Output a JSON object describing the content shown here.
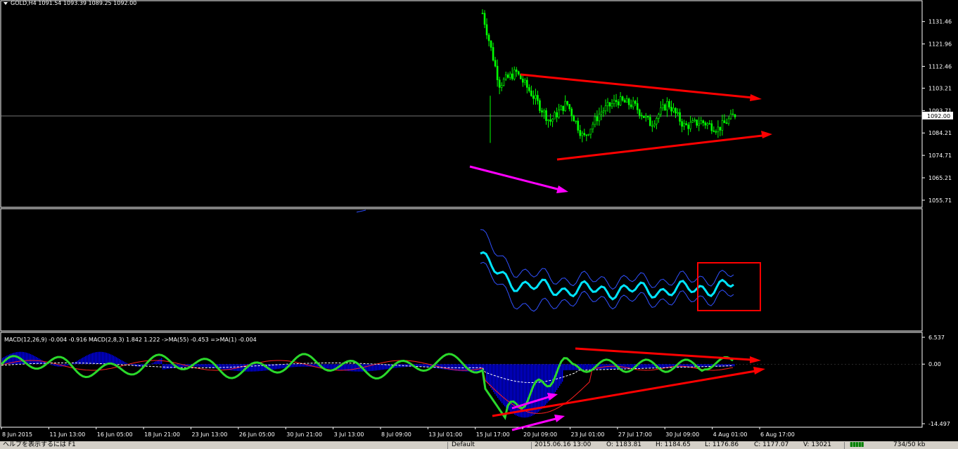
{
  "chart_title": "GOLD,H4  1091.54 1093.39 1089.25 1092.00",
  "current_price_label": "1092.00",
  "price_axis_labels": [
    "1131.46",
    "1121.96",
    "1112.46",
    "1103.21",
    "1093.71",
    "1084.21",
    "1074.71",
    "1065.21",
    "1055.71"
  ],
  "price_axis_values": [
    1131.46,
    1121.96,
    1112.46,
    1103.21,
    1093.71,
    1084.21,
    1074.71,
    1065.21,
    1055.71
  ],
  "macd_header": "MACD(12,26,9) -0.004 -0.916  MACD(2,8,3) 1.842 1.222  ->MA(55) -0.453  =>MA(1) -0.004",
  "macd_axis_labels": [
    "6.537",
    "0.00",
    "-14.497"
  ],
  "macd_axis_values": [
    6.537,
    0.0,
    -14.497
  ],
  "time_labels": [
    "8 Jun 2015",
    "11 Jun 13:00",
    "16 Jun 05:00",
    "18 Jun 21:00",
    "23 Jun 13:00",
    "26 Jun 05:00",
    "30 Jun 21:00",
    "3 Jul 13:00",
    "8 Jul 09:00",
    "13 Jul 01:00",
    "15 Jul 17:00",
    "20 Jul 09:00",
    "23 Jul 01:00",
    "27 Jul 17:00",
    "30 Jul 09:00",
    "4 Aug 01:00",
    "6 Aug 17:00"
  ],
  "status_bar": {
    "help": "ヘルプを表示するには F1",
    "profile": "Default",
    "datetime": "2015.06.16 13:00",
    "open": "O: 1183.81",
    "high": "H: 1184.65",
    "low": "L: 1176.86",
    "close": "C: 1177.07",
    "volume": "V: 13021",
    "traffic": "734/50 kb"
  },
  "colors": {
    "background": "#000000",
    "candle_up": "#00ff00",
    "candle_down": "#00ff00",
    "trendline": "#ff0000",
    "arrow_magenta": "#ff00ff",
    "indicator_main": "#00e5ff",
    "indicator_band": "#3050ff",
    "macd_hist": "#0000ff",
    "macd_fast": "#2bd92b",
    "macd_signal_red": "#ff2020",
    "macd_ma_white": "#ffffff",
    "highlight_box": "#ff0000"
  },
  "chart_data": [
    {
      "type": "candlestick",
      "title": "GOLD,H4",
      "x_start": "8 Jun 2015",
      "x_end": "6 Aug 17:00",
      "ylim": [
        1053,
        1140
      ],
      "last_close": 1092.0,
      "visible_close_path": [
        {
          "t": "17 Jul",
          "v": 1135
        },
        {
          "t": "20 Jul 01:00",
          "v": 1105
        },
        {
          "t": "20 Jul 09:00",
          "v": 1110
        },
        {
          "t": "21 Jul",
          "v": 1100
        },
        {
          "t": "22 Jul",
          "v": 1089
        },
        {
          "t": "23 Jul 01:00",
          "v": 1097
        },
        {
          "t": "24 Jul",
          "v": 1082
        },
        {
          "t": "25 Jul",
          "v": 1093
        },
        {
          "t": "27 Jul 17:00",
          "v": 1098
        },
        {
          "t": "29 Jul",
          "v": 1096
        },
        {
          "t": "30 Jul 09:00",
          "v": 1088
        },
        {
          "t": "31 Jul",
          "v": 1097
        },
        {
          "t": "3 Aug",
          "v": 1087
        },
        {
          "t": "4 Aug 01:00",
          "v": 1089
        },
        {
          "t": "5 Aug",
          "v": 1086
        },
        {
          "t": "6 Aug 17:00",
          "v": 1092
        }
      ]
    },
    {
      "type": "line",
      "title": "",
      "series": [
        {
          "values": [
            null,
            null,
            null,
            null,
            null,
            null,
            null,
            null,
            null,
            null,
            null,
            40,
            30,
            34,
            32,
            33,
            32,
            31,
            30,
            31,
            33
          ]
        }
      ]
    },
    {
      "type": "bar",
      "title": "MACD(12,26,9)",
      "ylim": [
        -14.497,
        6.537
      ],
      "values_main": -0.004,
      "values_signal": -0.916,
      "series": [
        {
          "name": "MACD(2,8,3)",
          "value": 1.842
        },
        {
          "name": "MA(55)",
          "value": -0.453
        },
        {
          "name": "MA(1)",
          "value": -0.004
        }
      ]
    }
  ]
}
